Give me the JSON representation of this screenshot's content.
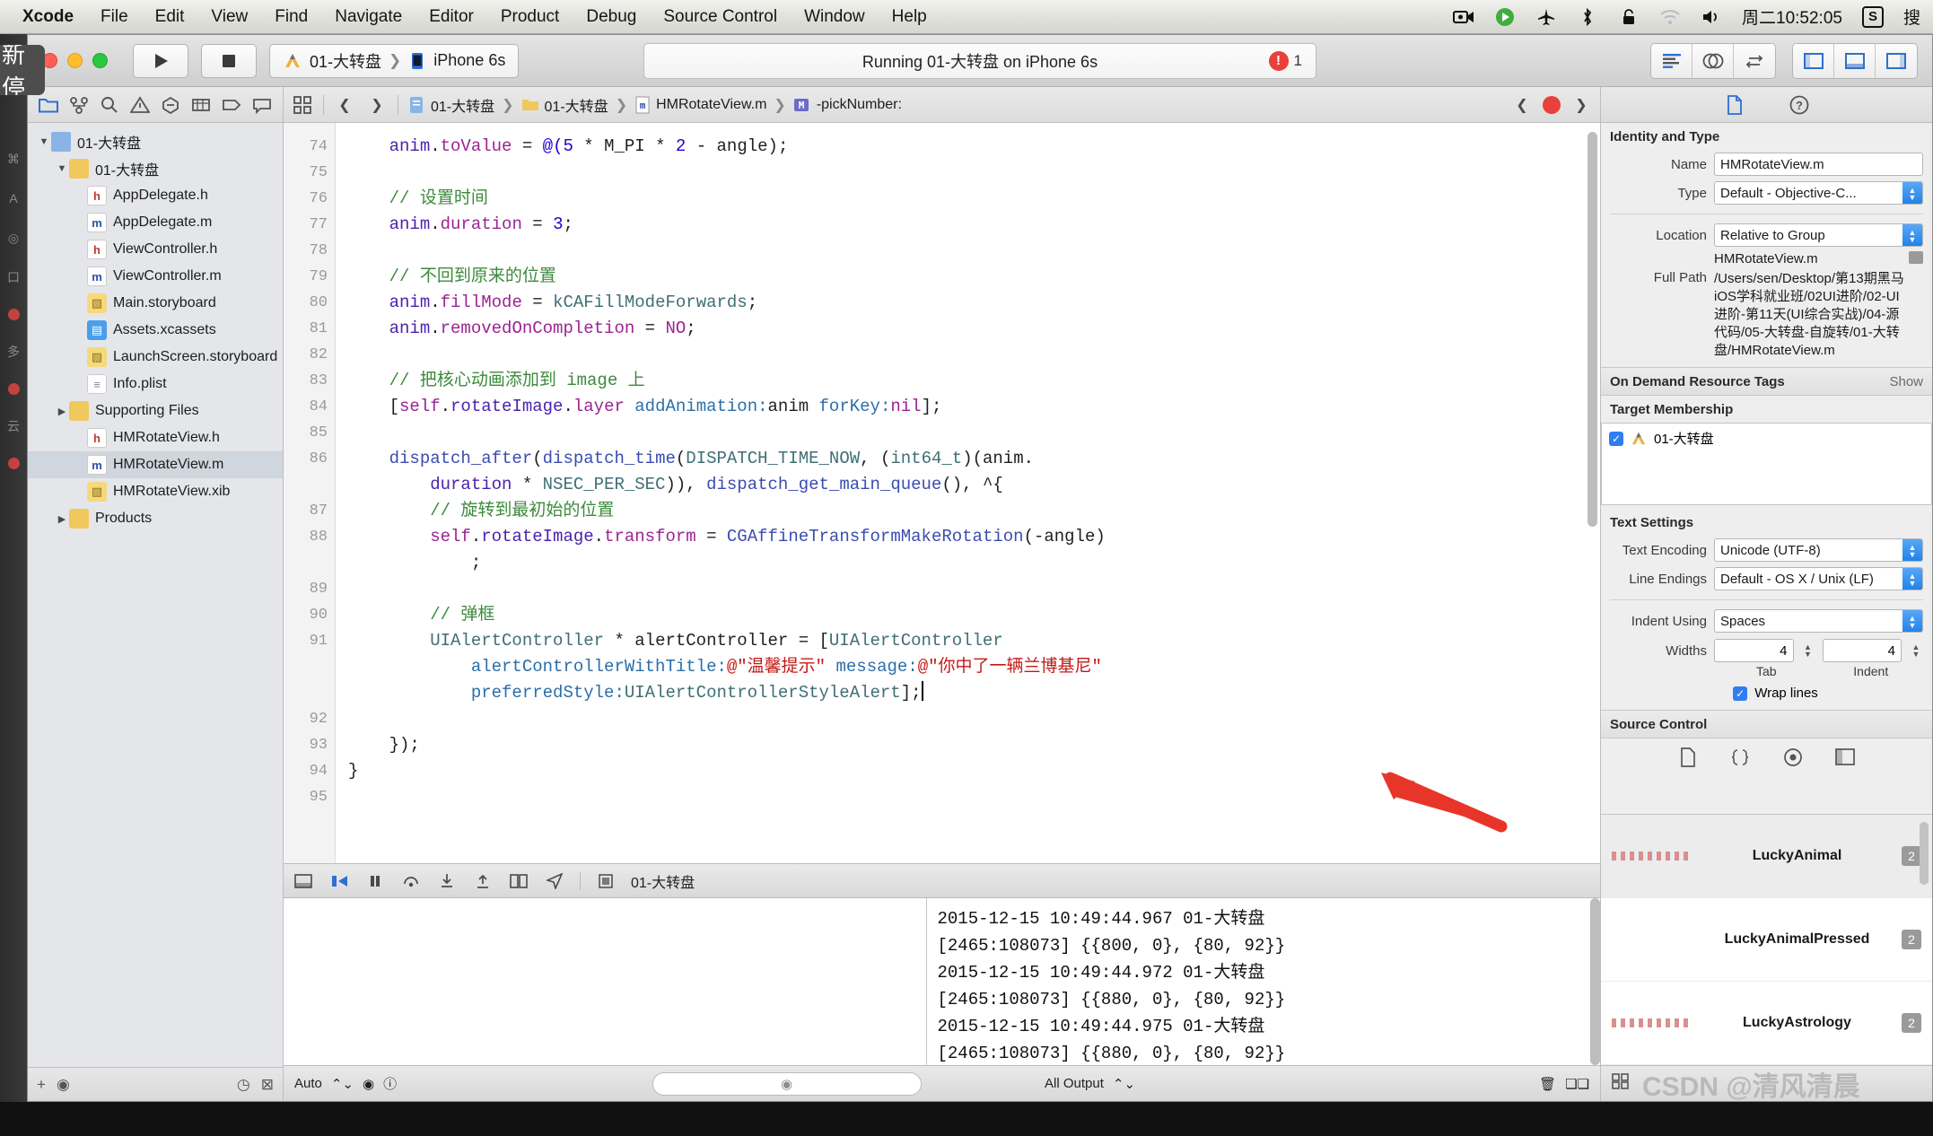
{
  "menubar": {
    "items": [
      "Xcode",
      "File",
      "Edit",
      "View",
      "Find",
      "Navigate",
      "Editor",
      "Product",
      "Debug",
      "Source Control",
      "Window",
      "Help"
    ],
    "status_icons": [
      "screen-record-icon",
      "play-green-icon",
      "airplane-icon",
      "bluetooth-icon",
      "lock-icon",
      "wifi-icon",
      "volume-icon"
    ],
    "clock": "周二10:52:05",
    "s_badge": "S",
    "trailing_cn": "搜"
  },
  "tooltip": {
    "text": "新停"
  },
  "toolbar": {
    "run_label": "run-button",
    "stop_label": "stop-button",
    "scheme_name": "01-大转盘",
    "device_name": "iPhone 6s",
    "status_text": "Running 01-大转盘 on iPhone 6s",
    "error_count": "1",
    "editor_modes": [
      "standard-editor",
      "assistant-editor",
      "version-editor"
    ],
    "view_toggles": [
      "navigator-toggle",
      "debug-toggle",
      "utilities-toggle"
    ]
  },
  "navigator": {
    "tabs": [
      "folder-icon",
      "vcs-icon",
      "search-icon",
      "warning-icon",
      "test-icon",
      "debug-icon",
      "breakpoint-icon",
      "report-icon"
    ],
    "tree": [
      {
        "label": "01-大转盘",
        "depth": 0,
        "icon": "project",
        "twisty": "▼",
        "selected": false
      },
      {
        "label": "01-大转盘",
        "depth": 1,
        "icon": "folder",
        "twisty": "▼",
        "selected": false
      },
      {
        "label": "AppDelegate.h",
        "depth": 2,
        "icon": "h",
        "twisty": "",
        "selected": false
      },
      {
        "label": "AppDelegate.m",
        "depth": 2,
        "icon": "m",
        "twisty": "",
        "selected": false
      },
      {
        "label": "ViewController.h",
        "depth": 2,
        "icon": "h",
        "twisty": "",
        "selected": false
      },
      {
        "label": "ViewController.m",
        "depth": 2,
        "icon": "m",
        "twisty": "",
        "selected": false
      },
      {
        "label": "Main.storyboard",
        "depth": 2,
        "icon": "sb",
        "twisty": "",
        "selected": false
      },
      {
        "label": "Assets.xcassets",
        "depth": 2,
        "icon": "xc",
        "twisty": "",
        "selected": false
      },
      {
        "label": "LaunchScreen.storyboard",
        "depth": 2,
        "icon": "sb",
        "twisty": "",
        "selected": false
      },
      {
        "label": "Info.plist",
        "depth": 2,
        "icon": "plist",
        "twisty": "",
        "selected": false
      },
      {
        "label": "Supporting Files",
        "depth": 1,
        "icon": "folder",
        "twisty": "▶",
        "selected": false
      },
      {
        "label": "HMRotateView.h",
        "depth": 2,
        "icon": "h",
        "twisty": "",
        "selected": false
      },
      {
        "label": "HMRotateView.m",
        "depth": 2,
        "icon": "m",
        "twisty": "",
        "selected": true
      },
      {
        "label": "HMRotateView.xib",
        "depth": 2,
        "icon": "xib",
        "twisty": "",
        "selected": false
      },
      {
        "label": "Products",
        "depth": 1,
        "icon": "folder",
        "twisty": "▶",
        "selected": false
      }
    ],
    "filter_add": "+",
    "filter_icons": [
      "filter-add-icon",
      "filter-recent-icon"
    ]
  },
  "jumpbar": {
    "crumbs": [
      {
        "label": "01-大转盘",
        "icon": "project"
      },
      {
        "label": "01-大转盘",
        "icon": "folder"
      },
      {
        "label": "HMRotateView.m",
        "icon": "m"
      },
      {
        "label": "-pickNumber:",
        "icon": "method"
      }
    ]
  },
  "code": {
    "first_line": 74,
    "lines": [
      {
        "n": "74",
        "html": "    <span class='id'>anim</span>.<span class='kw'>toValue</span> = <span class='nm'>@(</span><span class='nm'>5</span> * M_PI * <span class='nm'>2</span> - angle);"
      },
      {
        "n": "75",
        "html": ""
      },
      {
        "n": "76",
        "html": "    <span class='cm'>// 设置时间</span>"
      },
      {
        "n": "77",
        "html": "    <span class='id'>anim</span>.<span class='kw'>duration</span> = <span class='nm'>3</span>;"
      },
      {
        "n": "78",
        "html": ""
      },
      {
        "n": "79",
        "html": "    <span class='cm'>// 不回到原来的位置</span>"
      },
      {
        "n": "80",
        "html": "    <span class='id'>anim</span>.<span class='kw'>fillMode</span> = <span class='ty'>kCAFillModeForwards</span>;"
      },
      {
        "n": "81",
        "html": "    <span class='id'>anim</span>.<span class='kw'>removedOnCompletion</span> = <span class='kw'>NO</span>;"
      },
      {
        "n": "82",
        "html": ""
      },
      {
        "n": "83",
        "html": "    <span class='cm'>// 把核心动画添加到 image 上</span>"
      },
      {
        "n": "84",
        "html": "    [<span class='kw'>self</span>.<span class='id'>rotateImage</span>.<span class='kw'>layer</span> <span class='mtd'>addAnimation:</span>anim <span class='mtd'>forKey:</span><span class='kw'>nil</span>];"
      },
      {
        "n": "85",
        "html": ""
      },
      {
        "n": "86",
        "html": "    <span class='pr'>dispatch_after</span>(<span class='pr'>dispatch_time</span>(<span class='ty'>DISPATCH_TIME_NOW</span>, (<span class='ty'>int64_t</span>)(anim."
      },
      {
        "n": "",
        "html": "        <span class='id'>duration</span> * <span class='ty'>NSEC_PER_SEC</span>)), <span class='pr'>dispatch_get_main_queue</span>(), ^{"
      },
      {
        "n": "87",
        "html": "        <span class='cm'>// 旋转到最初始的位置</span>"
      },
      {
        "n": "88",
        "html": "        <span class='kw'>self</span>.<span class='id'>rotateImage</span>.<span class='kw'>transform</span> = <span class='pr'>CGAffineTransformMakeRotation</span>(-angle)"
      },
      {
        "n": "",
        "html": "            ;"
      },
      {
        "n": "89",
        "html": ""
      },
      {
        "n": "90",
        "html": "        <span class='cm'>// 弹框</span>"
      },
      {
        "n": "91",
        "html": "        <span class='ty'>UIAlertController</span> * alertController = [<span class='ty'>UIAlertController</span>"
      },
      {
        "n": "",
        "html": "            <span class='mtd'>alertControllerWithTitle:</span><span class='st'>@\"温馨提示\"</span> <span class='mtd'>message:</span><span class='st'>@\"你中了一辆兰博基尼\"</span>"
      },
      {
        "n": "",
        "html": "            <span class='mtd'>preferredStyle:</span><span class='ty'>UIAlertControllerStyleAlert</span>];<span class='cursor'></span>"
      },
      {
        "n": "92",
        "html": ""
      },
      {
        "n": "93",
        "html": "    });"
      },
      {
        "n": "94",
        "html": "}"
      },
      {
        "n": "95",
        "html": ""
      }
    ]
  },
  "debug": {
    "toolbar_icons": [
      "hide-debug-icon",
      "continue-icon",
      "pause-icon",
      "step-over-icon",
      "step-into-icon",
      "step-out-icon",
      "view-debug-icon",
      "location-icon",
      "process-icon"
    ],
    "process_label": "01-大转盘",
    "console_lines": [
      "2015-12-15 10:49:44.967 01-大转盘",
      "[2465:108073] {{800, 0}, {80, 92}}",
      "2015-12-15 10:49:44.972 01-大转盘",
      "[2465:108073] {{880, 0}, {80, 92}}",
      "2015-12-15 10:49:44.975 01-大转盘",
      "[2465:108073] {{880, 0}, {80, 92}}"
    ],
    "auto_label": "Auto",
    "filter_placeholder": "",
    "output_label": "All Output",
    "trash_icon": "trash-icon"
  },
  "inspector": {
    "tabs": [
      "file-inspector-icon",
      "quick-help-icon"
    ],
    "identity_title": "Identity and Type",
    "fields": {
      "name_label": "Name",
      "name_value": "HMRotateView.m",
      "type_label": "Type",
      "type_value": "Default - Objective-C...",
      "location_label": "Location",
      "location_value": "Relative to Group",
      "location_file": "HMRotateView.m",
      "fullpath_label": "Full Path",
      "fullpath_value": "/Users/sen/Desktop/第13期黑马iOS学科就业班/02UI进阶/02-UI进阶-第11天(UI综合实战)/04-源代码/05-大转盘-自旋转/01-大转盘/HMRotateView.m"
    },
    "odr_title": "On Demand Resource Tags",
    "odr_show": "Show",
    "target_title": "Target Membership",
    "target_item": "01-大转盘",
    "text_settings_title": "Text Settings",
    "text_encoding_label": "Text Encoding",
    "text_encoding_value": "Unicode (UTF-8)",
    "line_endings_label": "Line Endings",
    "line_endings_value": "Default - OS X / Unix (LF)",
    "indent_using_label": "Indent Using",
    "indent_using_value": "Spaces",
    "widths_label": "Widths",
    "tab_width": "4",
    "indent_width": "4",
    "tab_sub": "Tab",
    "indent_sub": "Indent",
    "wrap_lines_label": "Wrap lines",
    "source_control_title": "Source Control"
  },
  "library": {
    "items": [
      {
        "name": "LuckyAnimal",
        "badge": "2",
        "selected": true,
        "has_thumb": true
      },
      {
        "name": "LuckyAnimalPressed",
        "badge": "2",
        "selected": false,
        "has_thumb": false
      },
      {
        "name": "LuckyAstrology",
        "badge": "2",
        "selected": false,
        "has_thumb": true
      }
    ],
    "watermark": "CSDN @清风清晨"
  },
  "colors": {
    "accent_blue": "#2f7ef0",
    "error_red": "#e8403a",
    "string_red": "#c41a16",
    "comment_green": "#3c8a3c",
    "keyword_purple": "#9b2393",
    "arrow_red": "#e8352a",
    "selection_gray": "#cfd6dd"
  }
}
